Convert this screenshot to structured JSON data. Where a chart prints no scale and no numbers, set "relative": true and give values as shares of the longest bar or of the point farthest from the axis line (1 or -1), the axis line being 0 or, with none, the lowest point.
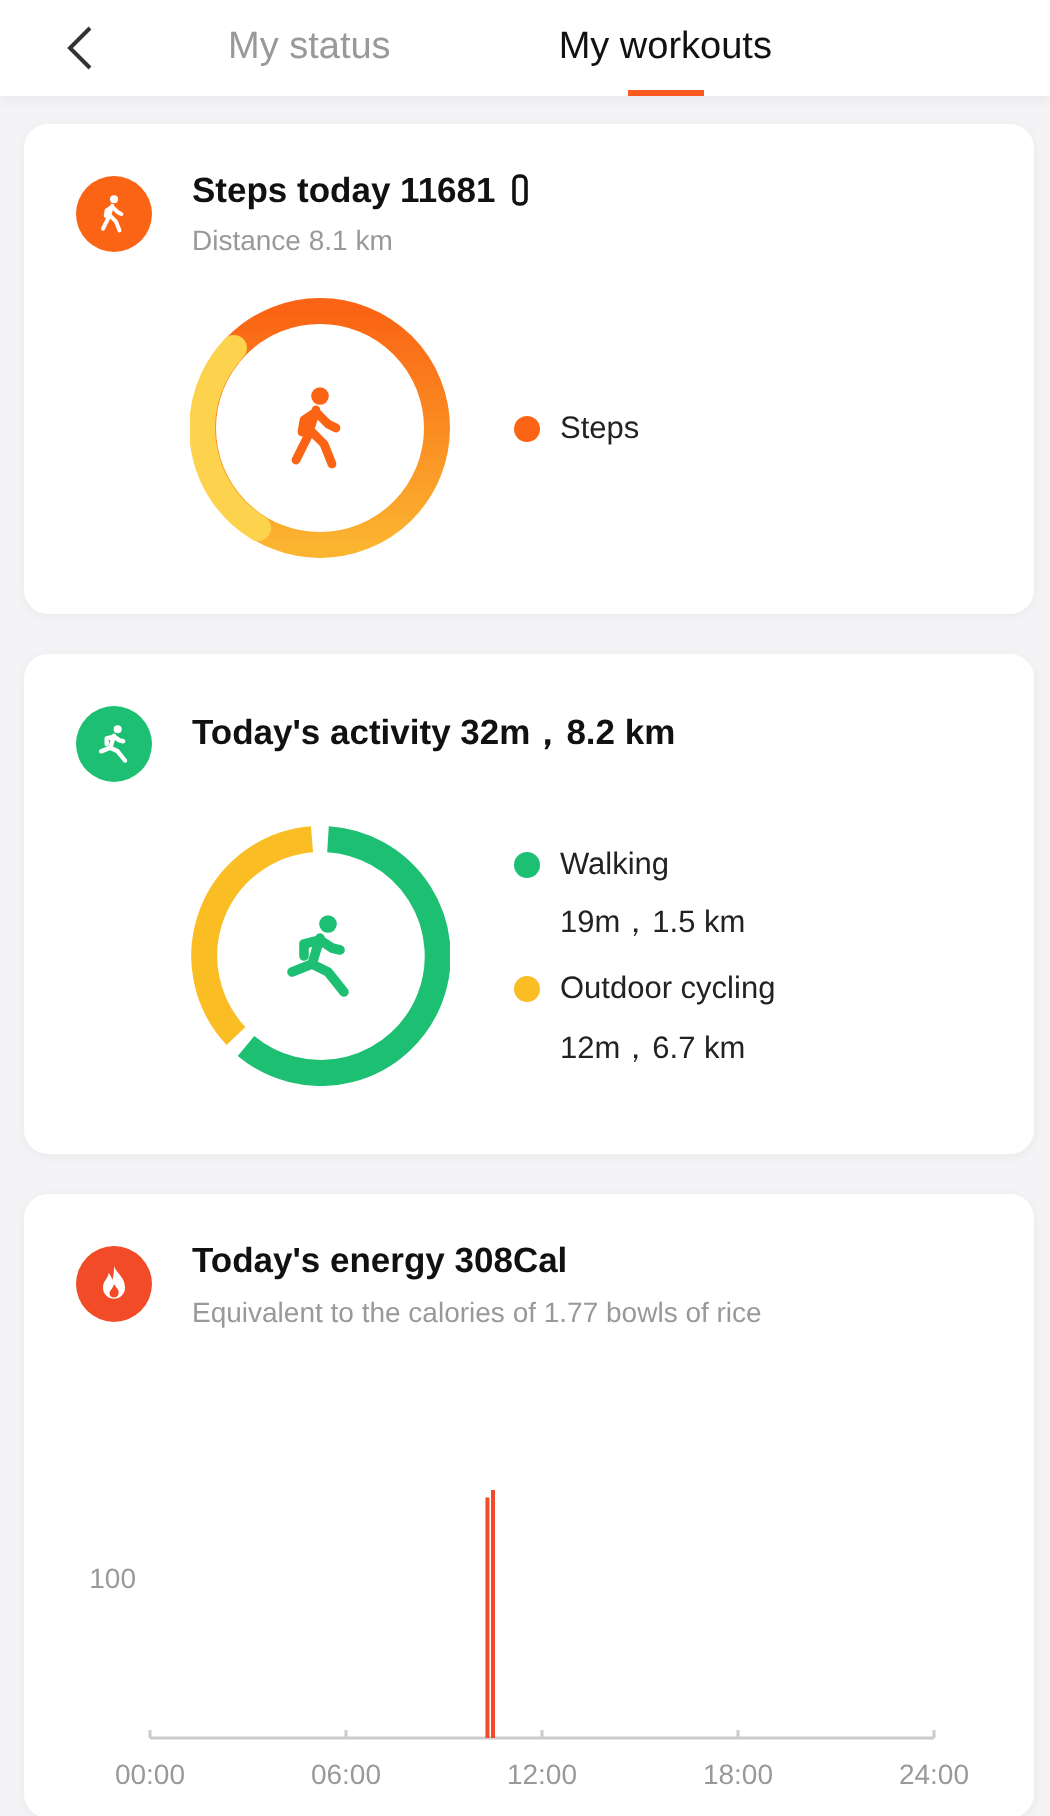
{
  "header": {
    "tabs": [
      {
        "label": "My status",
        "selected": false
      },
      {
        "label": "My workouts",
        "selected": true
      }
    ]
  },
  "cards": [
    {
      "kind": "steps",
      "title": "Steps today 11681",
      "subtitle": "Distance 8.1 km",
      "legend": [
        {
          "label": "Steps",
          "color": "#fa6414"
        }
      ]
    },
    {
      "kind": "activity",
      "title": "Today's activity 32m，8.2 km",
      "legend": [
        {
          "label": "Walking",
          "detail": "19m，1.5 km",
          "color": "#1dbf73"
        },
        {
          "label": "Outdoor cycling",
          "detail": "12m，6.7 km",
          "color": "#fbbd24"
        }
      ]
    },
    {
      "kind": "energy",
      "title": "Today's energy 308Cal",
      "subtitle": "Equivalent to the calories of 1.77 bowls of rice",
      "chart_data": {
        "type": "bar",
        "x": [
          10.33,
          10.5
        ],
        "values": [
          0.97,
          1
        ],
        "xlim": [
          0,
          24
        ],
        "xticks": [
          {
            "value": 0,
            "label": "00:00"
          },
          {
            "value": 6,
            "label": "06:00"
          },
          {
            "value": 12,
            "label": "12:00"
          },
          {
            "value": 18,
            "label": "18:00"
          },
          {
            "value": 24,
            "label": "24:00"
          }
        ],
        "relative": true,
        "annotations": [
          "100"
        ]
      }
    }
  ]
}
